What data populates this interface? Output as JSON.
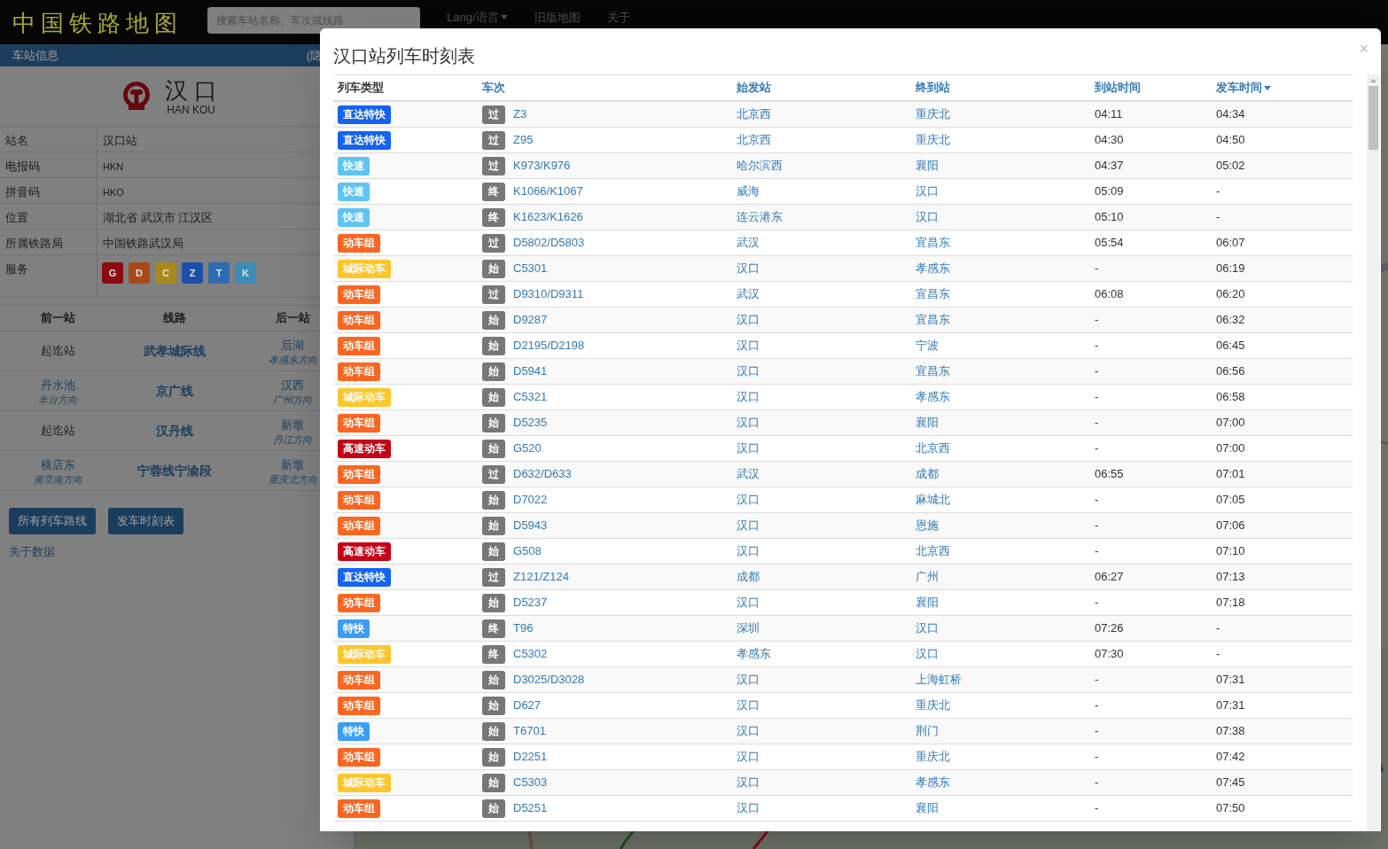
{
  "header": {
    "title": "中国铁路地图",
    "search": {
      "placeholder": "搜索车站名称、车次或线路"
    },
    "nav": [
      {
        "label": "Lang/语言",
        "dropdown": true
      },
      {
        "label": "旧版地图",
        "dropdown": false
      },
      {
        "label": "关于",
        "dropdown": false
      }
    ]
  },
  "sidebar": {
    "heading": "车站信息",
    "toggle": "(隐",
    "station": {
      "name": "汉 口",
      "pinyin": "HAN KOU"
    },
    "info": [
      {
        "label": "站名",
        "value": "汉口站",
        "kind": "text"
      },
      {
        "label": "电报码",
        "value": "HKN",
        "kind": "code"
      },
      {
        "label": "拼音码",
        "value": "HKO",
        "kind": "code"
      },
      {
        "label": "位置",
        "value": "湖北省 武汉市 江汉区",
        "kind": "text"
      },
      {
        "label": "所属铁路局",
        "value": "中国铁路武汉局",
        "kind": "text"
      },
      {
        "label": "服务",
        "kind": "services",
        "services": [
          {
            "label": "G",
            "color": "#8a0a10"
          },
          {
            "label": "D",
            "color": "#a84a18"
          },
          {
            "label": "C",
            "color": "#a88a1c"
          },
          {
            "label": "Z",
            "color": "#1c4fa8"
          },
          {
            "label": "T",
            "color": "#2d6cb0"
          },
          {
            "label": "K",
            "color": "#3d8cb8"
          }
        ]
      }
    ],
    "lines": {
      "columns": [
        "前一站",
        "线路",
        "后一站"
      ],
      "rows": [
        {
          "prev": {
            "name": "起迄站",
            "terminal": true
          },
          "line": "武孝城际线",
          "next": {
            "name": "后湖",
            "direction": "孝感东方向",
            "terminal": false
          }
        },
        {
          "prev": {
            "name": "丹水池",
            "direction": "丰台方向",
            "terminal": false
          },
          "line": "京广线",
          "next": {
            "name": "汉西",
            "direction": "广州方向",
            "terminal": false
          }
        },
        {
          "prev": {
            "name": "起迄站",
            "terminal": true
          },
          "line": "汉丹线",
          "next": {
            "name": "新墩",
            "direction": "丹江方向",
            "terminal": false
          }
        },
        {
          "prev": {
            "name": "横店东",
            "direction": "南京南方向",
            "terminal": false
          },
          "line": "宁蓉线宁渝段",
          "next": {
            "name": "新墩",
            "direction": "重庆北方向",
            "terminal": false
          }
        }
      ]
    },
    "buttons": [
      "所有列车路线",
      "发车时刻表"
    ],
    "link": "关于数据"
  },
  "modal": {
    "title": "汉口站列车时刻表",
    "close": "×",
    "columns": [
      {
        "label": "列车类型",
        "sortable": false,
        "sorted": false
      },
      {
        "label": "车次",
        "sortable": true,
        "sorted": false
      },
      {
        "label": "始发站",
        "sortable": true,
        "sorted": false
      },
      {
        "label": "终到站",
        "sortable": true,
        "sorted": false
      },
      {
        "label": "到站时间",
        "sortable": true,
        "sorted": false
      },
      {
        "label": "发车时间",
        "sortable": true,
        "sorted": true
      }
    ],
    "rows": [
      {
        "type": "直达特快",
        "color": "#1463f3",
        "stop": "过",
        "train": "Z3",
        "from": "北京西",
        "to": "重庆北",
        "arrive": "04:11",
        "depart": "04:34"
      },
      {
        "type": "直达特快",
        "color": "#1463f3",
        "stop": "过",
        "train": "Z95",
        "from": "北京西",
        "to": "重庆北",
        "arrive": "04:30",
        "depart": "04:50"
      },
      {
        "type": "快速",
        "color": "#5ec4f5",
        "stop": "过",
        "train": "K973/K976",
        "from": "哈尔滨西",
        "to": "襄阳",
        "arrive": "04:37",
        "depart": "05:02"
      },
      {
        "type": "快速",
        "color": "#5ec4f5",
        "stop": "终",
        "train": "K1066/K1067",
        "from": "威海",
        "to": "汉口",
        "arrive": "05:09",
        "depart": "-"
      },
      {
        "type": "快速",
        "color": "#5ec4f5",
        "stop": "终",
        "train": "K1623/K1626",
        "from": "连云港东",
        "to": "汉口",
        "arrive": "05:10",
        "depart": "-"
      },
      {
        "type": "动车组",
        "color": "#fc6620",
        "stop": "过",
        "train": "D5802/D5803",
        "from": "武汉",
        "to": "宜昌东",
        "arrive": "05:54",
        "depart": "06:07"
      },
      {
        "type": "城际动车",
        "color": "#fdc62a",
        "stop": "始",
        "train": "C5301",
        "from": "汉口",
        "to": "孝感东",
        "arrive": "-",
        "depart": "06:19"
      },
      {
        "type": "动车组",
        "color": "#fc6620",
        "stop": "过",
        "train": "D9310/D9311",
        "from": "武汉",
        "to": "宜昌东",
        "arrive": "06:08",
        "depart": "06:20"
      },
      {
        "type": "动车组",
        "color": "#fc6620",
        "stop": "始",
        "train": "D9287",
        "from": "汉口",
        "to": "宜昌东",
        "arrive": "-",
        "depart": "06:32"
      },
      {
        "type": "动车组",
        "color": "#fc6620",
        "stop": "始",
        "train": "D2195/D2198",
        "from": "汉口",
        "to": "宁波",
        "arrive": "-",
        "depart": "06:45"
      },
      {
        "type": "动车组",
        "color": "#fc6620",
        "stop": "始",
        "train": "D5941",
        "from": "汉口",
        "to": "宜昌东",
        "arrive": "-",
        "depart": "06:56"
      },
      {
        "type": "城际动车",
        "color": "#fdc62a",
        "stop": "始",
        "train": "C5321",
        "from": "汉口",
        "to": "孝感东",
        "arrive": "-",
        "depart": "06:58"
      },
      {
        "type": "动车组",
        "color": "#fc6620",
        "stop": "始",
        "train": "D5235",
        "from": "汉口",
        "to": "襄阳",
        "arrive": "-",
        "depart": "07:00"
      },
      {
        "type": "高速动车",
        "color": "#c70016",
        "stop": "始",
        "train": "G520",
        "from": "汉口",
        "to": "北京西",
        "arrive": "-",
        "depart": "07:00"
      },
      {
        "type": "动车组",
        "color": "#fc6620",
        "stop": "过",
        "train": "D632/D633",
        "from": "武汉",
        "to": "成都",
        "arrive": "06:55",
        "depart": "07:01"
      },
      {
        "type": "动车组",
        "color": "#fc6620",
        "stop": "始",
        "train": "D7022",
        "from": "汉口",
        "to": "麻城北",
        "arrive": "-",
        "depart": "07:05"
      },
      {
        "type": "动车组",
        "color": "#fc6620",
        "stop": "始",
        "train": "D5943",
        "from": "汉口",
        "to": "恩施",
        "arrive": "-",
        "depart": "07:06"
      },
      {
        "type": "高速动车",
        "color": "#c70016",
        "stop": "始",
        "train": "G508",
        "from": "汉口",
        "to": "北京西",
        "arrive": "-",
        "depart": "07:10"
      },
      {
        "type": "直达特快",
        "color": "#1463f3",
        "stop": "过",
        "train": "Z121/Z124",
        "from": "成都",
        "to": "广州",
        "arrive": "06:27",
        "depart": "07:13"
      },
      {
        "type": "动车组",
        "color": "#fc6620",
        "stop": "始",
        "train": "D5237",
        "from": "汉口",
        "to": "襄阳",
        "arrive": "-",
        "depart": "07:18"
      },
      {
        "type": "特快",
        "color": "#3d9df5",
        "stop": "终",
        "train": "T96",
        "from": "深圳",
        "to": "汉口",
        "arrive": "07:26",
        "depart": "-"
      },
      {
        "type": "城际动车",
        "color": "#fdc62a",
        "stop": "终",
        "train": "C5302",
        "from": "孝感东",
        "to": "汉口",
        "arrive": "07:30",
        "depart": "-"
      },
      {
        "type": "动车组",
        "color": "#fc6620",
        "stop": "始",
        "train": "D3025/D3028",
        "from": "汉口",
        "to": "上海虹桥",
        "arrive": "-",
        "depart": "07:31"
      },
      {
        "type": "动车组",
        "color": "#fc6620",
        "stop": "始",
        "train": "D627",
        "from": "汉口",
        "to": "重庆北",
        "arrive": "-",
        "depart": "07:31"
      },
      {
        "type": "特快",
        "color": "#3d9df5",
        "stop": "始",
        "train": "T6701",
        "from": "汉口",
        "to": "荆门",
        "arrive": "-",
        "depart": "07:38"
      },
      {
        "type": "动车组",
        "color": "#fc6620",
        "stop": "始",
        "train": "D2251",
        "from": "汉口",
        "to": "重庆北",
        "arrive": "-",
        "depart": "07:42"
      },
      {
        "type": "城际动车",
        "color": "#fdc62a",
        "stop": "始",
        "train": "C5303",
        "from": "汉口",
        "to": "孝感东",
        "arrive": "-",
        "depart": "07:45"
      },
      {
        "type": "动车组",
        "color": "#fc6620",
        "stop": "始",
        "train": "D5251",
        "from": "汉口",
        "to": "襄阳",
        "arrive": "-",
        "depart": "07:50"
      }
    ]
  }
}
